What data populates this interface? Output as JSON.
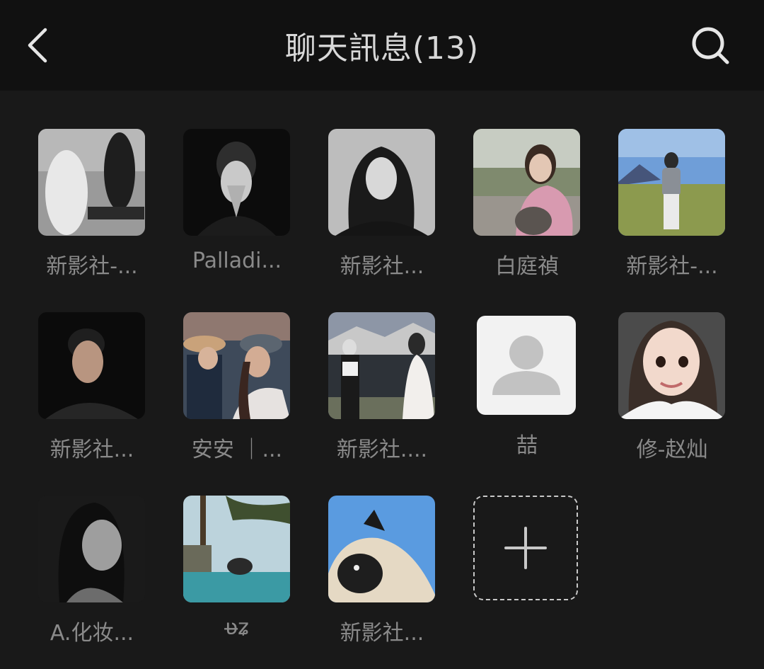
{
  "header": {
    "title": "聊天訊息(13)",
    "back_icon": "chevron-left-icon",
    "search_icon": "search-icon"
  },
  "members": [
    {
      "name": "新影社-..."
    },
    {
      "name": "Palladi..."
    },
    {
      "name": "新影社..."
    },
    {
      "name": "白庭禎"
    },
    {
      "name": "新影社-..."
    },
    {
      "name": "新影社..."
    },
    {
      "name": "安安 ｜..."
    },
    {
      "name": "新影社...."
    },
    {
      "name": "喆"
    },
    {
      "name": "修-赵灿"
    },
    {
      "name": "A.化妆..."
    },
    {
      "name": "ʋ̶ʑ"
    },
    {
      "name": "新影社..."
    }
  ],
  "add_member": {
    "icon": "plus-icon"
  },
  "colors": {
    "background": "#191919",
    "header_background": "#111111",
    "title_text": "#d8d8d8",
    "name_text": "#8a8a8a"
  }
}
